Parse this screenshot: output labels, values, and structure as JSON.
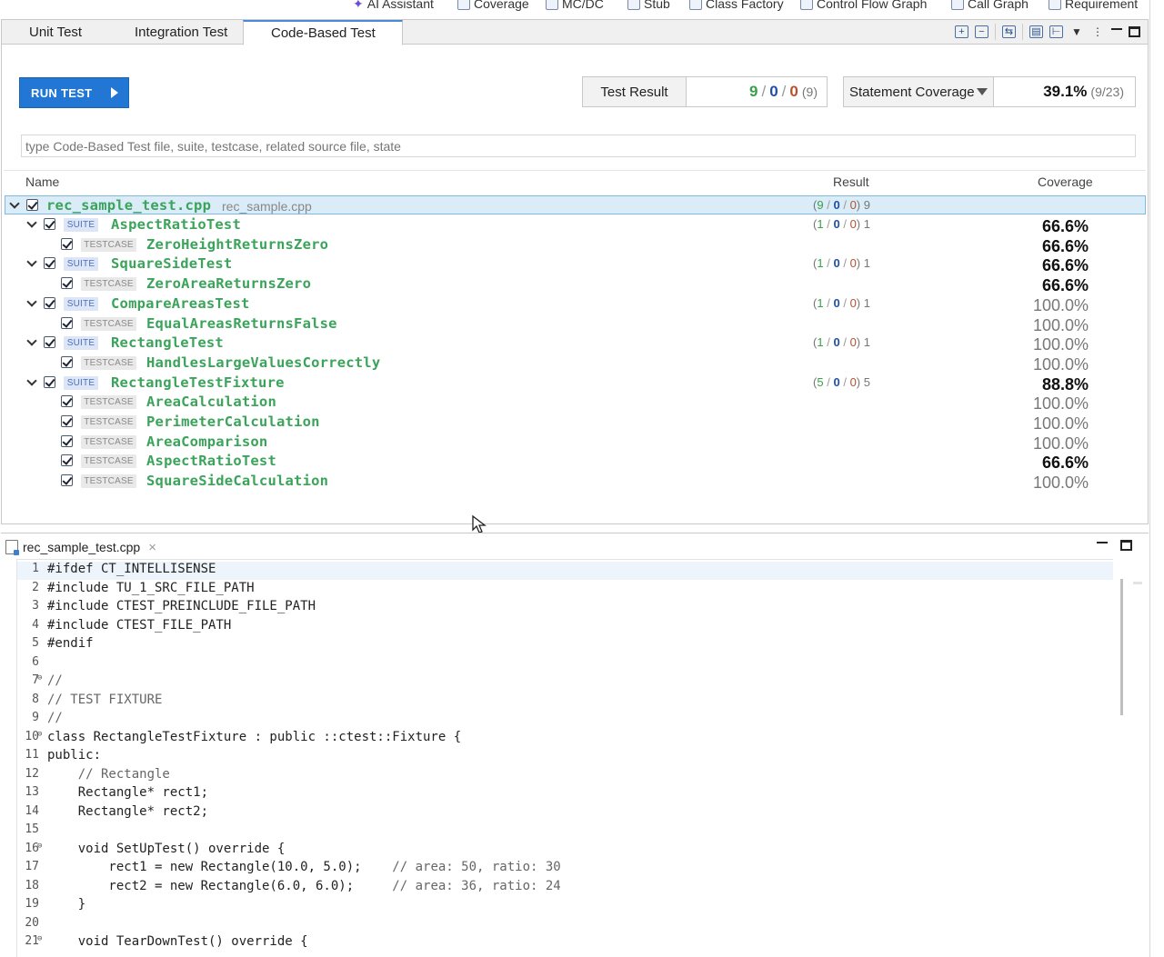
{
  "top_toolbar": [
    {
      "label": "AI Assistant",
      "icon": "ai-assistant-icon"
    },
    {
      "label": "Coverage",
      "icon": "coverage-icon"
    },
    {
      "label": "MC/DC",
      "icon": "mcdc-icon"
    },
    {
      "label": "Stub",
      "icon": "stub-icon"
    },
    {
      "label": "Class Factory",
      "icon": "class-factory-icon"
    },
    {
      "label": "Control Flow Graph",
      "icon": "control-flow-graph-icon"
    },
    {
      "label": "Call Graph",
      "icon": "call-graph-icon"
    },
    {
      "label": "Requirement",
      "icon": "requirement-icon"
    }
  ],
  "tabs": [
    {
      "label": "Unit Test",
      "active": false
    },
    {
      "label": "Integration  Test",
      "active": false
    },
    {
      "label": "Code-Based Test",
      "active": true
    }
  ],
  "run_button": {
    "label": "RUN TEST"
  },
  "test_result": {
    "label": "Test Result",
    "passed": "9",
    "failed": "0",
    "errors": "0",
    "total": "(9)"
  },
  "coverage": {
    "selected": "Statement Coverage",
    "percent": "39.1%",
    "fraction": "(9/23)"
  },
  "filter": {
    "placeholder": "type Code-Based Test file, suite, testcase, related source file, state"
  },
  "tree_header": {
    "name": "Name",
    "result": "Result",
    "coverage": "Coverage"
  },
  "tree": {
    "file": {
      "name": "rec_sample_test.cpp",
      "source": "rec_sample.cpp",
      "passed": "9",
      "failed": "0",
      "errors": "0",
      "total": "9"
    },
    "suite_badge": "SUITE",
    "testcase_badge": "TESTCASE",
    "rows": [
      {
        "type": "suite",
        "name": "AspectRatioTest",
        "passed": "1",
        "failed": "0",
        "errors": "0",
        "total": "1",
        "coverage": "66.6%"
      },
      {
        "type": "testcase",
        "name": "ZeroHeightReturnsZero",
        "coverage": "66.6%"
      },
      {
        "type": "suite",
        "name": "SquareSideTest",
        "passed": "1",
        "failed": "0",
        "errors": "0",
        "total": "1",
        "coverage": "66.6%"
      },
      {
        "type": "testcase",
        "name": "ZeroAreaReturnsZero",
        "coverage": "66.6%"
      },
      {
        "type": "suite",
        "name": "CompareAreasTest",
        "passed": "1",
        "failed": "0",
        "errors": "0",
        "total": "1",
        "coverage": "100.0%"
      },
      {
        "type": "testcase",
        "name": "EqualAreasReturnsFalse",
        "coverage": "100.0%"
      },
      {
        "type": "suite",
        "name": "RectangleTest",
        "passed": "1",
        "failed": "0",
        "errors": "0",
        "total": "1",
        "coverage": "100.0%"
      },
      {
        "type": "testcase",
        "name": "HandlesLargeValuesCorrectly",
        "coverage": "100.0%"
      },
      {
        "type": "suite",
        "name": "RectangleTestFixture",
        "passed": "5",
        "failed": "0",
        "errors": "0",
        "total": "5",
        "coverage": "88.8%"
      },
      {
        "type": "testcase",
        "name": "AreaCalculation",
        "coverage": "100.0%"
      },
      {
        "type": "testcase",
        "name": "PerimeterCalculation",
        "coverage": "100.0%"
      },
      {
        "type": "testcase",
        "name": "AreaComparison",
        "coverage": "100.0%"
      },
      {
        "type": "testcase",
        "name": "AspectRatioTest",
        "coverage": "66.6%"
      },
      {
        "type": "testcase",
        "name": "SquareSideCalculation",
        "coverage": "100.0%"
      }
    ]
  },
  "editor": {
    "tab_label": "rec_sample_test.cpp",
    "lines": [
      {
        "n": "1",
        "text": "#ifdef CT_INTELLISENSE"
      },
      {
        "n": "2",
        "text": "#include TU_1_SRC_FILE_PATH"
      },
      {
        "n": "3",
        "text": "#include CTEST_PREINCLUDE_FILE_PATH"
      },
      {
        "n": "4",
        "text": "#include CTEST_FILE_PATH"
      },
      {
        "n": "5",
        "text": "#endif"
      },
      {
        "n": "6",
        "text": ""
      },
      {
        "n": "7",
        "text": "//"
      },
      {
        "n": "8",
        "text": "// TEST FIXTURE"
      },
      {
        "n": "9",
        "text": "//"
      },
      {
        "n": "10",
        "text": "class RectangleTestFixture : public ::ctest::Fixture {"
      },
      {
        "n": "11",
        "text": "public:"
      },
      {
        "n": "12",
        "text": "    // Rectangle"
      },
      {
        "n": "13",
        "text": "    Rectangle* rect1;"
      },
      {
        "n": "14",
        "text": "    Rectangle* rect2;"
      },
      {
        "n": "15",
        "text": ""
      },
      {
        "n": "16",
        "text": "    void SetUpTest() override {"
      },
      {
        "n": "17",
        "text": "        rect1 = new Rectangle(10.0, 5.0);    // area: 50, ratio: 30"
      },
      {
        "n": "18",
        "text": "        rect2 = new Rectangle(6.0, 6.0);     // area: 36, ratio: 24"
      },
      {
        "n": "19",
        "text": "    }"
      },
      {
        "n": "20",
        "text": ""
      },
      {
        "n": "21",
        "text": "    void TearDownTest() override {"
      }
    ]
  }
}
